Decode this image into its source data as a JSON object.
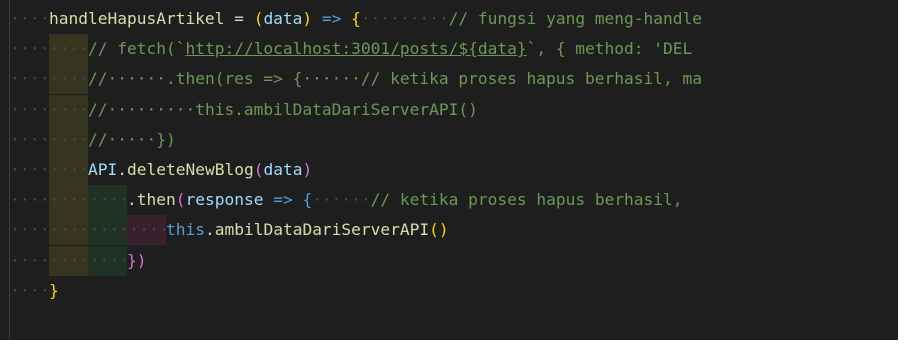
{
  "editor": {
    "lines": [
      {
        "ws": "····",
        "parts": [
          [
            "handleHapusArtikel",
            "c-fn"
          ],
          [
            " = ",
            "c-op"
          ],
          [
            "(",
            "c-br"
          ],
          [
            "data",
            "c-var"
          ],
          [
            ")",
            "c-br"
          ],
          [
            " => ",
            "c-arrow"
          ],
          [
            "{",
            "c-br"
          ],
          [
            "·········",
            "c-ws"
          ],
          [
            "// fungsi yang meng-handle",
            "c-cm"
          ]
        ]
      },
      {
        "ws": "········",
        "parts": [
          [
            "// fetch(`",
            "c-cm"
          ],
          [
            "http://localhost:3001/posts/${data}",
            "c-cm c-url"
          ],
          [
            "`, { method: 'DEL",
            "c-cm"
          ]
        ]
      },
      {
        "ws": "········",
        "parts": [
          [
            "//······.then(res => {······// ketika proses hapus berhasil, ma",
            "c-cm"
          ]
        ]
      },
      {
        "ws": "········",
        "parts": [
          [
            "//·········this.ambilDataDariServerAPI()",
            "c-cm"
          ]
        ]
      },
      {
        "ws": "········",
        "parts": [
          [
            "//·····})",
            "c-cm"
          ]
        ]
      },
      {
        "ws": "········",
        "parts": [
          [
            "API",
            "c-var"
          ],
          [
            ".",
            "c-op"
          ],
          [
            "deleteNewBlog",
            "c-fn"
          ],
          [
            "(",
            "c-br2"
          ],
          [
            "data",
            "c-var"
          ],
          [
            ")",
            "c-br2"
          ]
        ]
      },
      {
        "ws": "············",
        "parts": [
          [
            ".",
            "c-op"
          ],
          [
            "then",
            "c-fn"
          ],
          [
            "(",
            "c-br2"
          ],
          [
            "response",
            "c-var"
          ],
          [
            " => ",
            "c-arrow"
          ],
          [
            "{",
            "c-kw"
          ],
          [
            "······",
            "c-ws"
          ],
          [
            "// ketika proses hapus berhasil, ",
            "c-cm"
          ]
        ]
      },
      {
        "ws": "················",
        "parts": [
          [
            "this",
            "c-this"
          ],
          [
            ".",
            "c-op"
          ],
          [
            "ambilDataDariServerAPI",
            "c-fn"
          ],
          [
            "(",
            "c-br"
          ],
          [
            ")",
            "c-br"
          ]
        ]
      },
      {
        "ws": "············",
        "parts": [
          [
            "})",
            "c-br2"
          ]
        ]
      },
      {
        "ws": "····",
        "parts": [
          [
            "}",
            "c-br"
          ]
        ]
      }
    ]
  }
}
